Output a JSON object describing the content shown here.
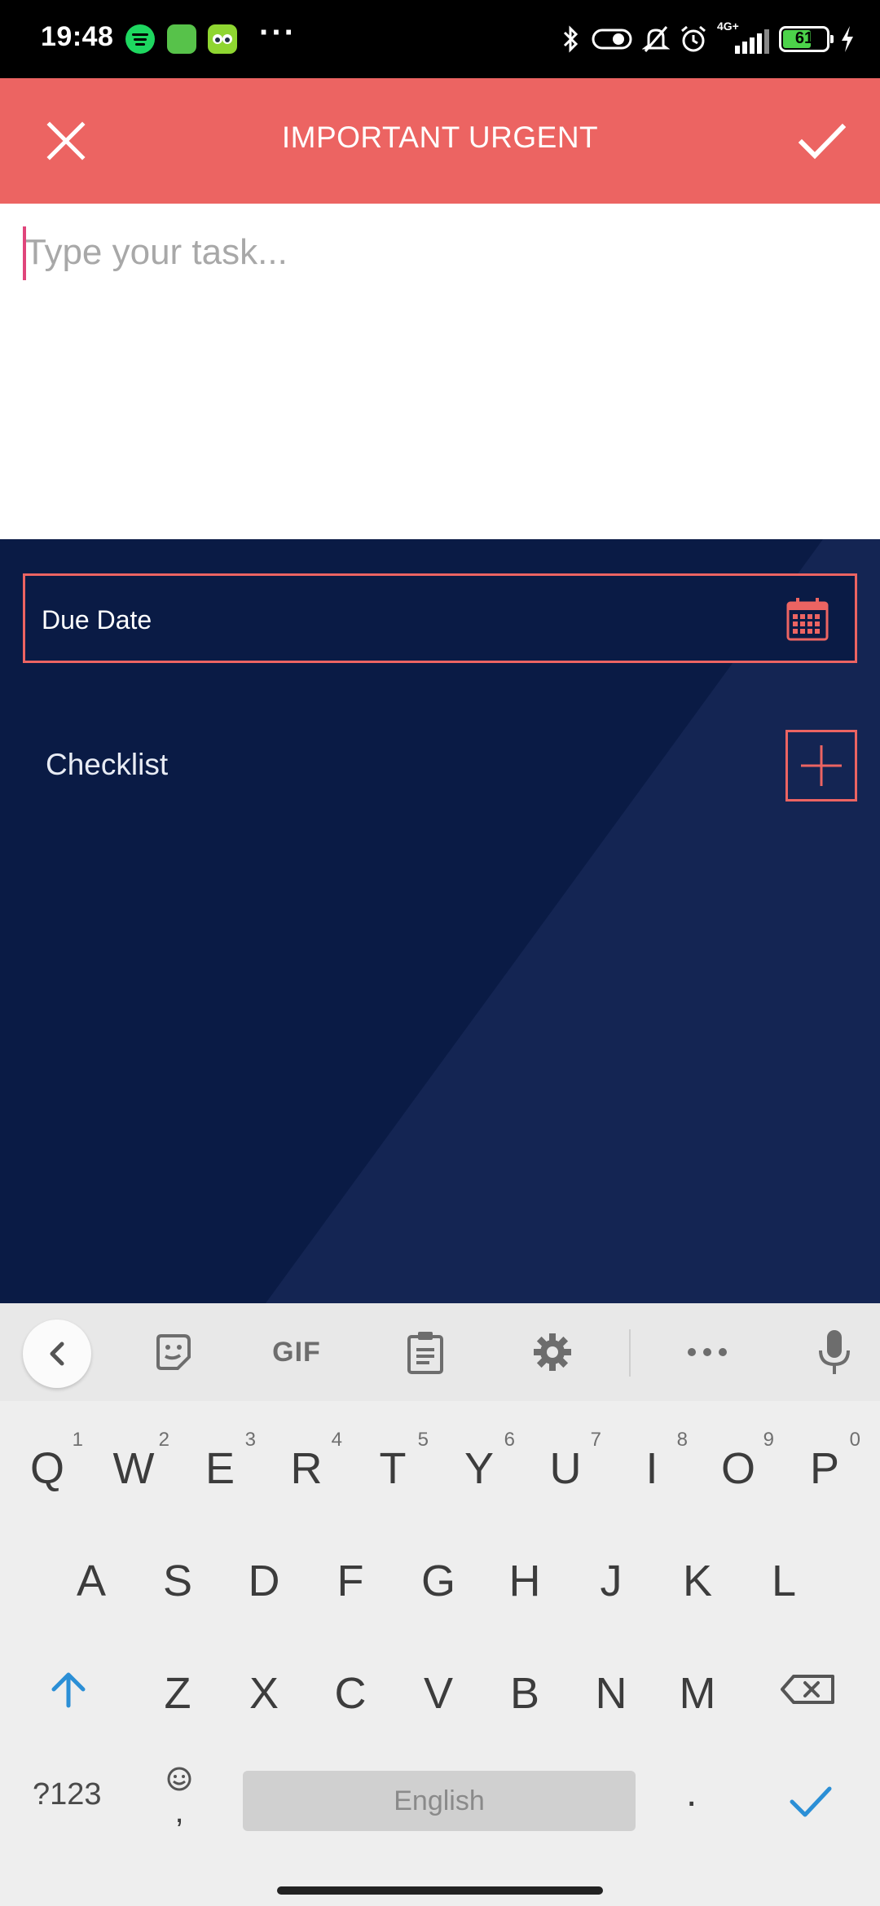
{
  "status_bar": {
    "time": "19:48",
    "network_label": "4G+",
    "battery_level": "61",
    "overflow": "···"
  },
  "app_bar": {
    "title": "IMPORTANT URGENT",
    "close_icon": "close-icon",
    "confirm_icon": "check-icon"
  },
  "task": {
    "placeholder": "Type your task...",
    "value": ""
  },
  "due_date": {
    "label": "Due Date",
    "icon": "calendar-icon"
  },
  "checklist": {
    "label": "Checklist",
    "add_icon": "plus-icon"
  },
  "colors": {
    "accent": "#ec6462",
    "panel_background": "#0a1b45",
    "keyboard_background": "#eeeeee",
    "keyboard_accent": "#2b8fd6"
  },
  "keyboard": {
    "toolbar": {
      "gif_label": "GIF"
    },
    "row1": [
      {
        "key": "Q",
        "num": "1"
      },
      {
        "key": "W",
        "num": "2"
      },
      {
        "key": "E",
        "num": "3"
      },
      {
        "key": "R",
        "num": "4"
      },
      {
        "key": "T",
        "num": "5"
      },
      {
        "key": "Y",
        "num": "6"
      },
      {
        "key": "U",
        "num": "7"
      },
      {
        "key": "I",
        "num": "8"
      },
      {
        "key": "O",
        "num": "9"
      },
      {
        "key": "P",
        "num": "0"
      }
    ],
    "row2": [
      "A",
      "S",
      "D",
      "F",
      "G",
      "H",
      "J",
      "K",
      "L"
    ],
    "row3": [
      "Z",
      "X",
      "C",
      "V",
      "B",
      "N",
      "M"
    ],
    "symbols_label": "?123",
    "comma_label": ",",
    "space_label": "English",
    "period_label": "."
  }
}
